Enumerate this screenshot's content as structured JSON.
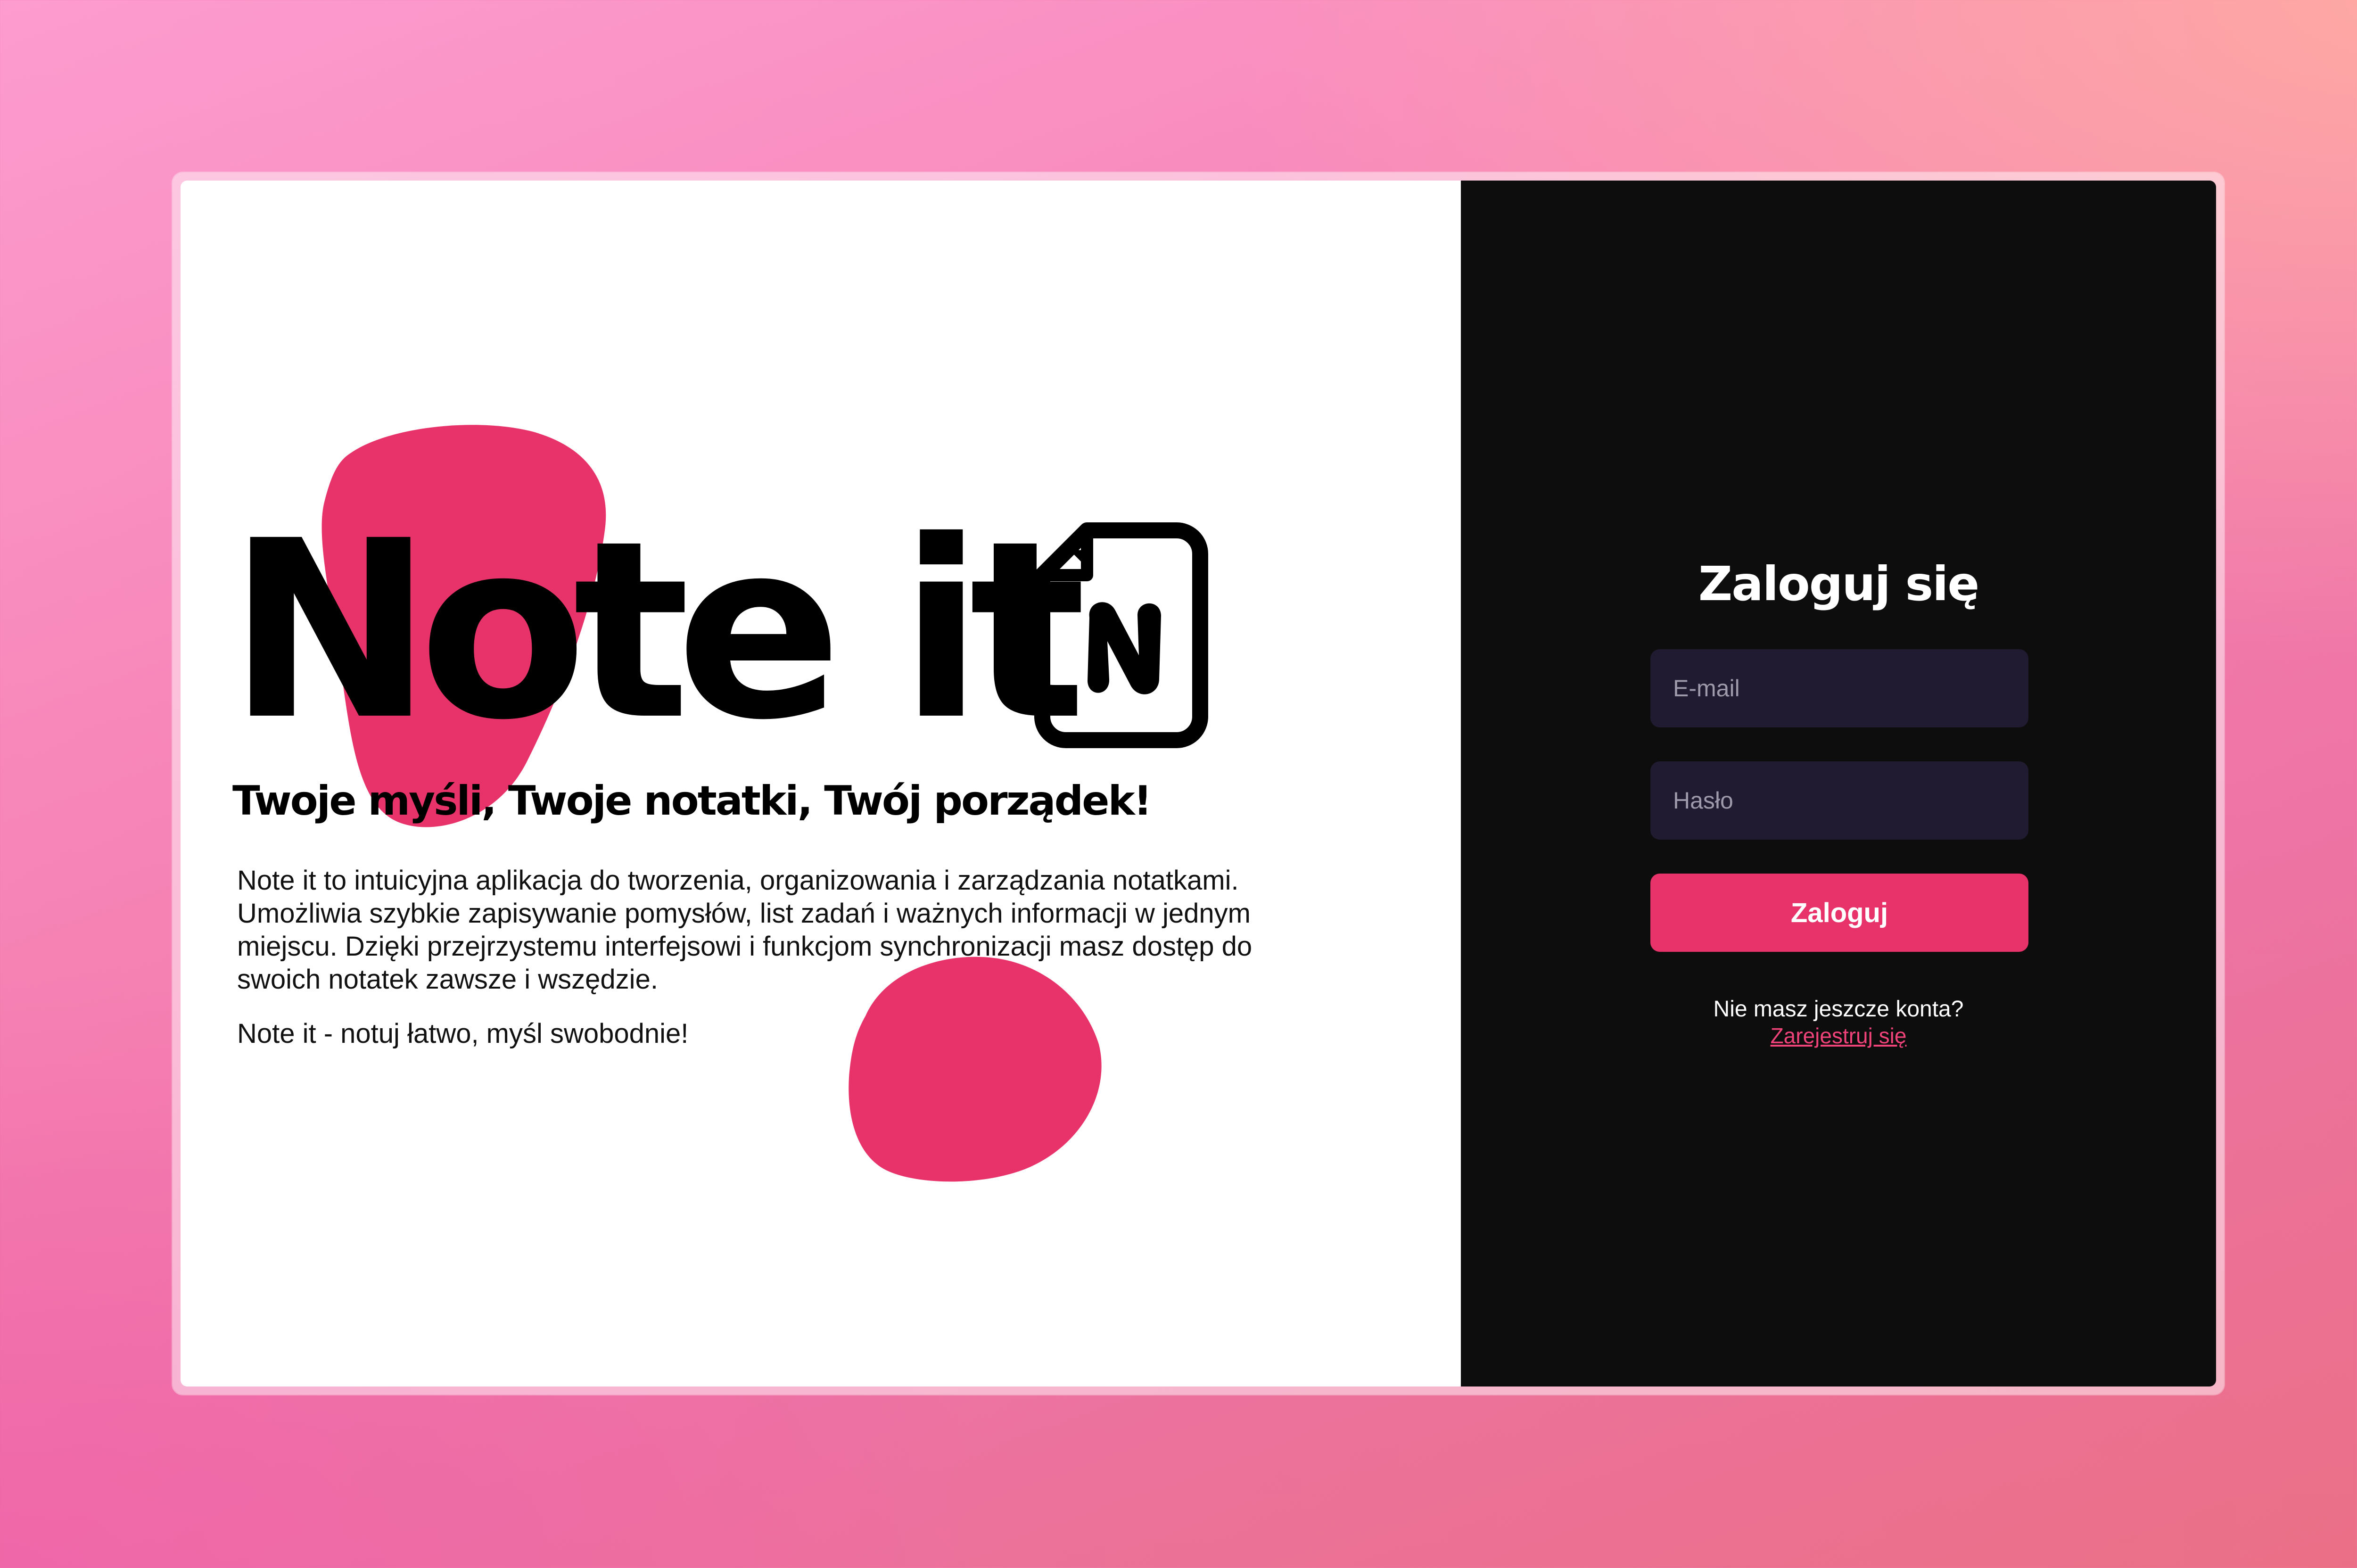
{
  "app": {
    "brand_name": "Note it",
    "tagline": "Twoje myśli, Twoje notatki, Twój porządek!",
    "description": "Note it to intuicyjna aplikacja do tworzenia, organizowania i zarządzania notatkami. Umożliwia szybkie zapisywanie pomysłów, list zadań i ważnych informacji w jednym miejscu. Dzięki przejrzystemu interfejsowi i funkcjom synchronizacji masz dostęp do swoich notatek zawsze i wszędzie.",
    "motto": "Note it - notuj łatwo, myśl swobodnie!",
    "logo_icon": "document-n-icon"
  },
  "login": {
    "title": "Zaloguj się",
    "email_placeholder": "E-mail",
    "email_value": "",
    "password_placeholder": "Hasło",
    "password_value": "",
    "submit_label": "Zaloguj",
    "register_prompt": "Nie masz jeszcze konta?",
    "register_link": "Zarejestruj się"
  },
  "colors": {
    "accent": "#e8336a",
    "dark_panel": "#0d0d0d",
    "input_background": "#211b31",
    "link": "#f0437a"
  }
}
